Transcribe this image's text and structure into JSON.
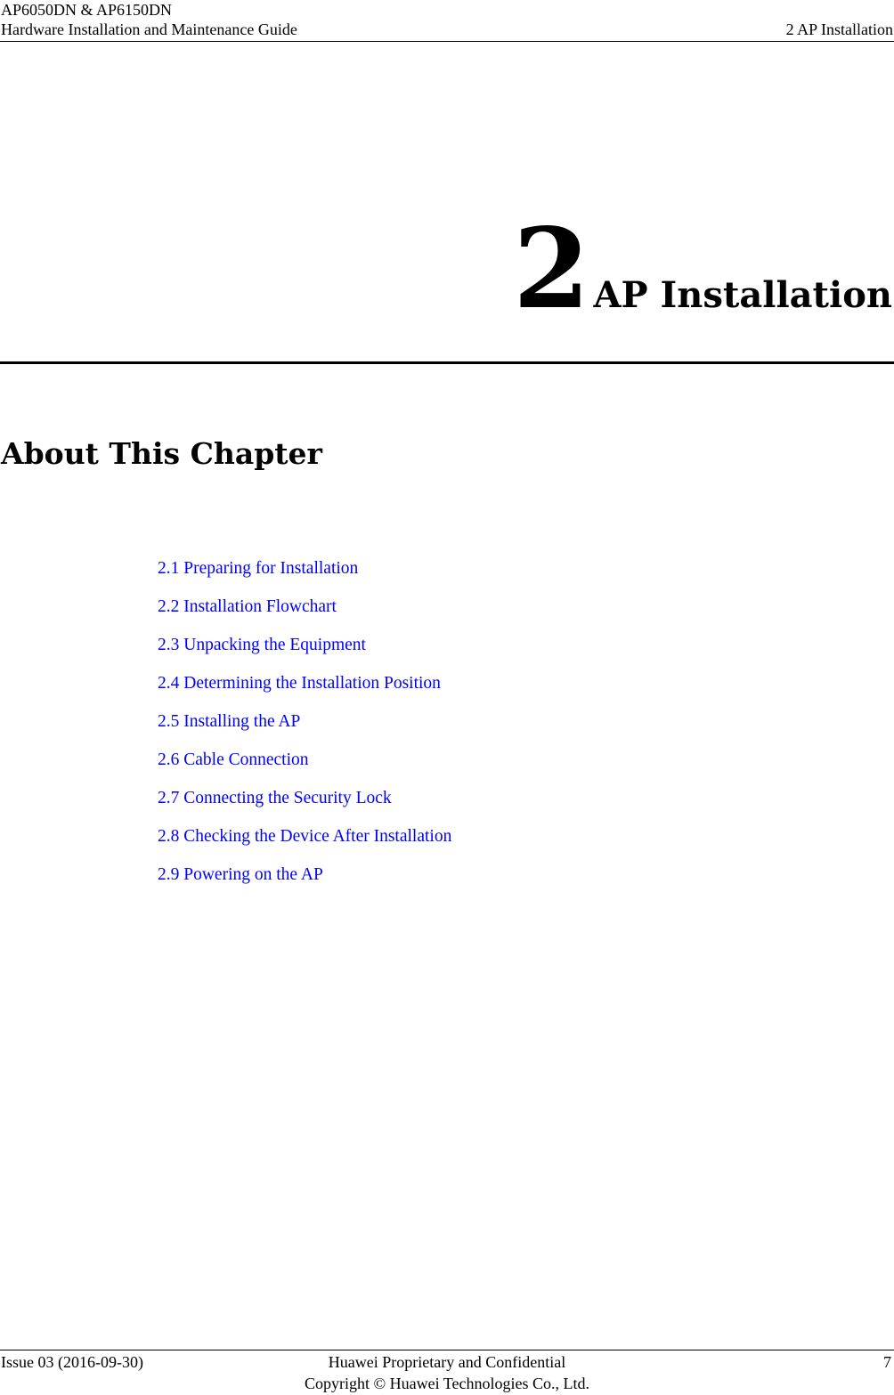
{
  "header": {
    "product": "AP6050DN & AP6150DN",
    "guide_title": "Hardware Installation and Maintenance Guide",
    "chapter_ref": "2 AP Installation"
  },
  "chapter": {
    "number": "2",
    "title": "AP Installation"
  },
  "about": {
    "heading": "About This Chapter"
  },
  "toc": {
    "link_color": "#0000ff",
    "items": [
      {
        "label": "2.1 Preparing for Installation"
      },
      {
        "label": "2.2 Installation Flowchart"
      },
      {
        "label": "2.3 Unpacking the Equipment"
      },
      {
        "label": "2.4 Determining the Installation Position"
      },
      {
        "label": "2.5 Installing the AP"
      },
      {
        "label": "2.6 Cable Connection"
      },
      {
        "label": "2.7 Connecting the Security Lock"
      },
      {
        "label": "2.8 Checking the Device After Installation"
      },
      {
        "label": "2.9 Powering on the AP"
      }
    ]
  },
  "footer": {
    "issue": "Issue 03 (2016-09-30)",
    "confidential": "Huawei Proprietary and Confidential",
    "copyright": "Copyright © Huawei Technologies Co., Ltd.",
    "page_number": "7"
  }
}
